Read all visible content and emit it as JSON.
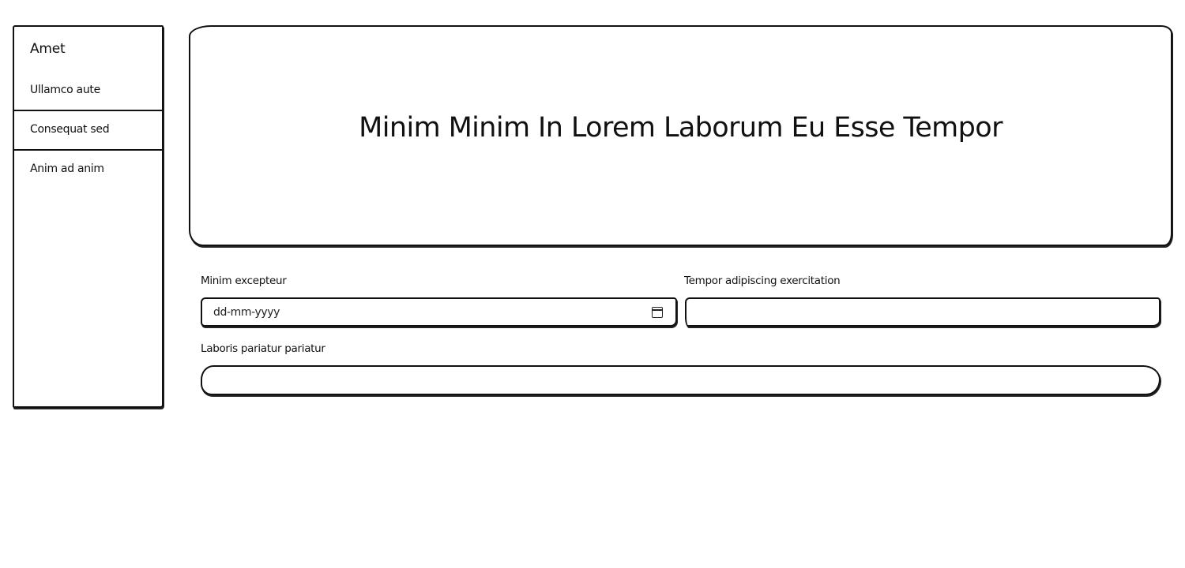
{
  "sidebar": {
    "title": "Amet",
    "items": [
      {
        "label": "Ullamco aute"
      },
      {
        "label": "Consequat sed"
      },
      {
        "label": "Anim ad anim"
      }
    ]
  },
  "hero": {
    "title": "Minim Minim In Lorem Laborum Eu Esse Tempor"
  },
  "form": {
    "field1": {
      "label": "Minim excepteur",
      "placeholder": "dd-mm-yyyy",
      "value": ""
    },
    "field2": {
      "label": "Tempor adipiscing exercitation",
      "value": ""
    },
    "field3": {
      "label": "Laboris pariatur pariatur",
      "value": ""
    }
  },
  "icons": {
    "date_picker": "calendar-icon"
  },
  "colors": {
    "border": "#111111",
    "background": "#ffffff",
    "text": "#111111"
  }
}
